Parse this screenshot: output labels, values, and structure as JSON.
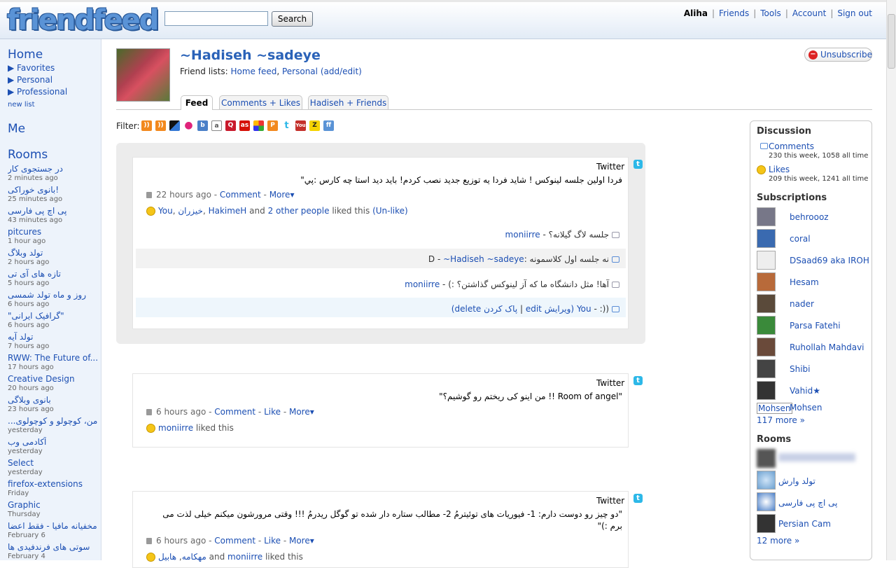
{
  "header": {
    "logo": "friendfeed",
    "search_button": "Search",
    "search_value": "",
    "nav": {
      "user": "Aliha",
      "friends": "Friends",
      "tools": "Tools",
      "account": "Account",
      "signout": "Sign out"
    }
  },
  "leftnav": {
    "home": "Home",
    "lists": [
      "Favorites",
      "Personal",
      "Professional"
    ],
    "new_list": "new list",
    "me": "Me",
    "rooms_title": "Rooms",
    "rooms": [
      {
        "name": "در جستجوی کار",
        "time": "2 minutes ago"
      },
      {
        "name": "بانوی خوراکی!",
        "time": "25 minutes ago"
      },
      {
        "name": "پی اچ پی فارسی",
        "time": "43 minutes ago"
      },
      {
        "name": "pitcures",
        "time": "1 hour ago"
      },
      {
        "name": "تولد وبلاگ",
        "time": "2 hours ago"
      },
      {
        "name": "تازه های آی تی",
        "time": "5 hours ago"
      },
      {
        "name": "روز و ماه تولد شمسی",
        "time": "6 hours ago"
      },
      {
        "name": "\"گرافیک ایرانی\"",
        "time": "6 hours ago"
      },
      {
        "name": "تولد آیه",
        "time": "7 hours ago"
      },
      {
        "name": "RWW: The Future of...",
        "time": "17 hours ago"
      },
      {
        "name": "Creative Design",
        "time": "20 hours ago"
      },
      {
        "name": "بانوی وبلاگی",
        "time": "23 hours ago"
      },
      {
        "name": "...من، کوچولو و کوچولوی",
        "time": "yesterday"
      },
      {
        "name": "آکادمی وب",
        "time": "yesterday"
      },
      {
        "name": "Select",
        "time": "yesterday"
      },
      {
        "name": "firefox-extensions",
        "time": "Friday"
      },
      {
        "name": "Graphic",
        "time": "Thursday"
      },
      {
        "name": "مخفیانه مافیا - فقط اعضا",
        "time": "February 6"
      },
      {
        "name": "سوتی های فرندفیدی ها",
        "time": "February 4"
      }
    ]
  },
  "profile": {
    "name": "~Hadiseh ~sadeye",
    "friend_lists_label": "Friend lists:",
    "friend_lists": [
      "Home feed",
      "Personal"
    ],
    "add_edit": "(add/edit)",
    "unsubscribe": "Unsubscribe",
    "tabs": [
      "Feed",
      "Comments + Likes",
      "Hadiseh + Friends"
    ],
    "filter_label": "Filter:"
  },
  "entries": [
    {
      "service": "Twitter",
      "text": "فردا اولین جلسه لینوکس ! شاید فردا یه توزیع جدید نصب کردم! باید دید استا چه کارس :پي\"",
      "time": "22 hours ago",
      "actions": [
        "Comment",
        "More"
      ],
      "likes": {
        "names": [
          "You",
          "خیزران",
          "HakimeH"
        ],
        "and": "and",
        "others": "2 other people",
        "suffix": "liked this",
        "unlike": "(Un-like)"
      },
      "comments": [
        {
          "text": "جلسه لاگ گیلانه؟",
          "author": "moniirre"
        },
        {
          "text": "نه جلسه اول کلاسمونه :D",
          "author": "~Hadiseh ~sadeye"
        },
        {
          "text": "آها! مثل دانشگاه ما که آز لینوکس گذاشتن؟ :)",
          "author": "moniirre"
        },
        {
          "text": "((:",
          "author": "You",
          "edit": "(ویرایش edit",
          "delete": "پاک کردن delete)"
        }
      ]
    },
    {
      "service": "Twitter",
      "text": "\"Room of angel !! من اینو کی ریختم رو گوشیم؟\"",
      "time": "6 hours ago",
      "actions": [
        "Comment",
        "Like",
        "More"
      ],
      "likes": {
        "names": [
          "moniirre"
        ],
        "suffix": "liked this"
      }
    },
    {
      "service": "Twitter",
      "text_line1": "\"دو چیز رو دوست دارم: 1- فیوریات های توئیترمُ 2- مطالب ستاره دار شده تو گوگل ریدرمُ !!! وقتی مرورشون میکنم خیلی لذت می",
      "text_line2": "برم :)\"",
      "time": "6 hours ago",
      "actions": [
        "Comment",
        "Like",
        "More"
      ],
      "likes": {
        "names": [
          "مهکامه",
          "هابیل"
        ],
        "and": "and",
        "others": "moniirre",
        "suffix": "liked this"
      }
    }
  ],
  "sidebar": {
    "discussion_title": "Discussion",
    "comments_label": "Comments",
    "comments_stats": "230 this week, 1058 all time",
    "likes_label": "Likes",
    "likes_stats": "209 this week, 1241 all time",
    "subscriptions_title": "Subscriptions",
    "subscriptions": [
      "behroooz",
      "coral",
      "DSaad69 aka IROH",
      "Hesam",
      "nader",
      "Parsa Fatehi",
      "Ruhollah Mahdavi",
      "Shibi",
      "Vahid★"
    ],
    "mohsen_label": "Mohsen",
    "mohsen_name": "Mohsen",
    "subs_more": "117 more »",
    "rooms_title": "Rooms",
    "rooms": [
      "",
      "تولد وارش",
      "پی اچ پی فارسی",
      "Persian Cam"
    ],
    "rooms_more": "12 more »"
  }
}
